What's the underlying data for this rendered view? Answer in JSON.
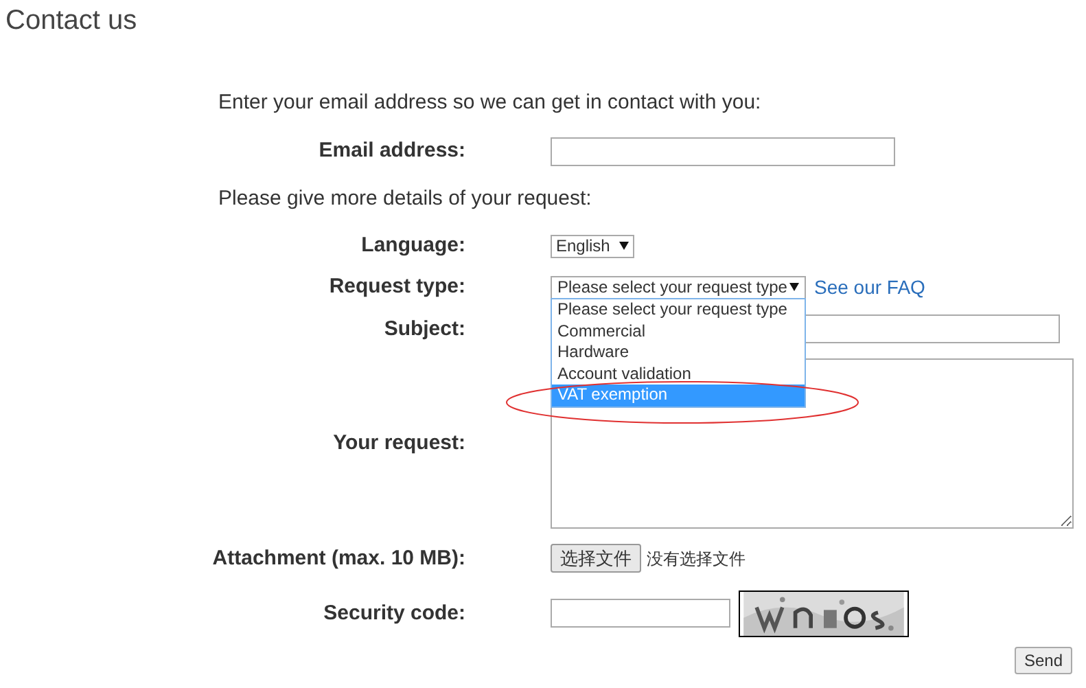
{
  "title": "Contact us",
  "intro_email": "Enter your email address so we can get in contact with you:",
  "email": {
    "label": "Email address:"
  },
  "intro_details": "Please give more details of your request:",
  "language": {
    "label": "Language:",
    "value": "English"
  },
  "request_type": {
    "label": "Request type:",
    "value": "Please select your request type",
    "expanded": true,
    "faq_link": "See our FAQ",
    "options": [
      {
        "label": "Please select your request type",
        "highlighted": false
      },
      {
        "label": "Commercial",
        "highlighted": false
      },
      {
        "label": "Hardware",
        "highlighted": false
      },
      {
        "label": "Account validation",
        "highlighted": false
      },
      {
        "label": "VAT exemption",
        "highlighted": true
      }
    ]
  },
  "subject": {
    "label": "Subject:"
  },
  "request": {
    "label": "Your request:"
  },
  "attachment": {
    "label": "Attachment (max. 10 MB):",
    "button": "选择文件",
    "status": "没有选择文件"
  },
  "security": {
    "label": "Security code:"
  },
  "send": "Send"
}
